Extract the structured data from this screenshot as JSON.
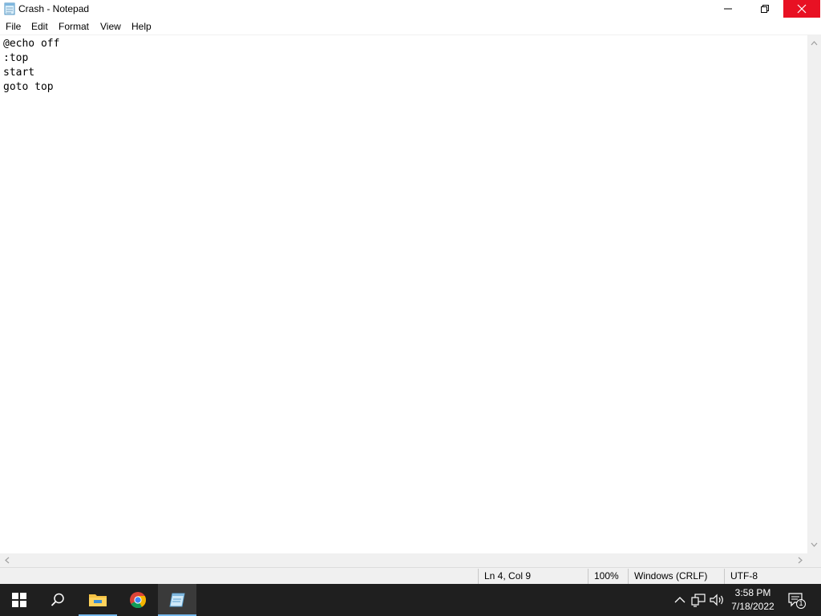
{
  "window": {
    "title": "Crash - Notepad",
    "close_color": "#e81123"
  },
  "menu": {
    "items": [
      "File",
      "Edit",
      "Format",
      "View",
      "Help"
    ]
  },
  "editor": {
    "lines": [
      "@echo off",
      ":top",
      "start",
      "goto top"
    ]
  },
  "status": {
    "position": "Ln 4, Col 9",
    "zoom": "100%",
    "line_endings": "Windows (CRLF)",
    "encoding": "UTF-8"
  },
  "taskbar": {
    "pinned": [
      "start-icon",
      "search-icon",
      "file-explorer-icon",
      "chrome-icon",
      "notepad-icon"
    ],
    "active": "notepad-icon",
    "time": "3:58 PM",
    "date": "7/18/2022",
    "notification_count": "1"
  }
}
